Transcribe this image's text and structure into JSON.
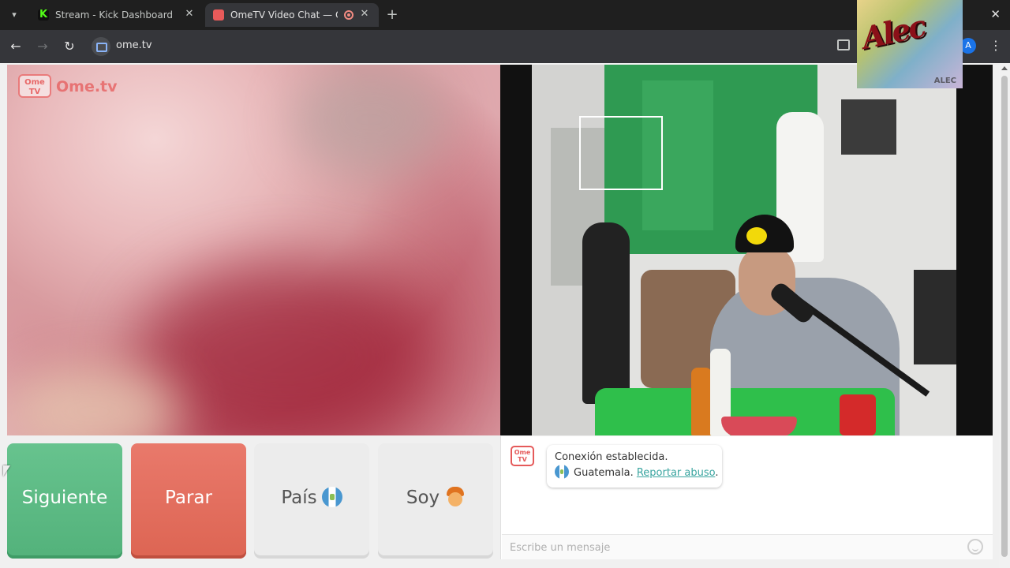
{
  "browser": {
    "tabs": [
      {
        "label": "Stream - Kick Dashboard",
        "favicon": "kick-icon",
        "active": false
      },
      {
        "label": "OmeTV Video Chat — Ome",
        "favicon": "ometv-icon",
        "active": true
      }
    ],
    "url": "ome.tv",
    "profile_initial": "A"
  },
  "overlay": {
    "graffiti_text": "Alec",
    "tag_text": "ALEC"
  },
  "ometv": {
    "logo_tv": "Ome\nTV",
    "logo_name": "Ome.tv",
    "buttons": {
      "next": "Siguiente",
      "stop": "Parar",
      "country": "País",
      "gender": "Soy"
    },
    "chat": {
      "avatar_label": "Ome\nTV",
      "status": "Conexión establecida.",
      "country": "Guatemala.",
      "report_link": "Reportar abuso",
      "report_suffix": ".",
      "input_placeholder": "Escribe un mensaje"
    }
  },
  "colors": {
    "next": "#5bb983",
    "stop": "#e26e5e",
    "brand": "#e55a5a",
    "link": "#3aa5a0"
  }
}
